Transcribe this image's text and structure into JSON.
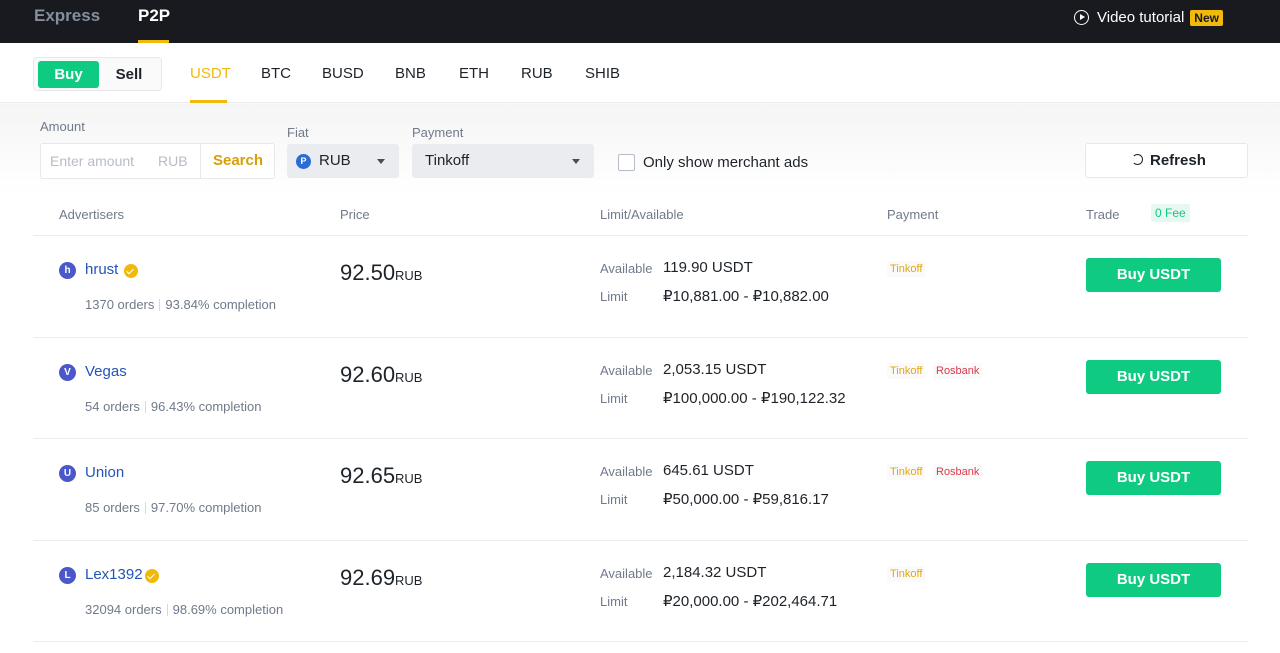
{
  "topbar": {
    "tabs": [
      "Express",
      "P2P"
    ],
    "active_tab": "P2P",
    "video_tutorial": "Video tutorial",
    "new_badge": "New"
  },
  "trade_toggle": {
    "buy": "Buy",
    "sell": "Sell",
    "active": "Buy"
  },
  "coins": [
    "USDT",
    "BTC",
    "BUSD",
    "BNB",
    "ETH",
    "RUB",
    "SHIB"
  ],
  "active_coin": "USDT",
  "filters": {
    "amount_label": "Amount",
    "amount_placeholder": "Enter amount",
    "amount_unit": "RUB",
    "search_label": "Search",
    "fiat_label": "Fiat",
    "fiat_icon": "P",
    "fiat_value": "RUB",
    "payment_label": "Payment",
    "payment_value": "Tinkoff",
    "merchant_checkbox_label": "Only show merchant ads",
    "merchant_checked": false,
    "refresh_label": "Refresh"
  },
  "table_header": {
    "advertisers": "Advertisers",
    "price": "Price",
    "limit_available": "Limit/Available",
    "payment": "Payment",
    "trade": "Trade",
    "fee_badge": "0 Fee"
  },
  "labels": {
    "available": "Available",
    "limit": "Limit"
  },
  "rows": [
    {
      "initial": "h",
      "name": "hrust",
      "verified": true,
      "orders": "1370 orders",
      "completion": "93.84% completion",
      "price": "92.50",
      "price_unit": "RUB",
      "available": "119.90 USDT",
      "limit": "₽10,881.00 - ₽10,882.00",
      "payments": [
        "Tinkoff"
      ],
      "button": "Buy USDT"
    },
    {
      "initial": "V",
      "name": "Vegas",
      "verified": false,
      "orders": "54 orders",
      "completion": "96.43% completion",
      "price": "92.60",
      "price_unit": "RUB",
      "available": "2,053.15 USDT",
      "limit": "₽100,000.00 - ₽190,122.32",
      "payments": [
        "Tinkoff",
        "Rosbank"
      ],
      "button": "Buy USDT"
    },
    {
      "initial": "U",
      "name": "Union",
      "verified": false,
      "orders": "85 orders",
      "completion": "97.70% completion",
      "price": "92.65",
      "price_unit": "RUB",
      "available": "645.61 USDT",
      "limit": "₽50,000.00 - ₽59,816.17",
      "payments": [
        "Tinkoff",
        "Rosbank"
      ],
      "button": "Buy USDT"
    },
    {
      "initial": "L",
      "name": "Lex1392",
      "verified": true,
      "orders": "32094 orders",
      "completion": "98.69% completion",
      "price": "92.69",
      "price_unit": "RUB",
      "available": "2,184.32 USDT",
      "limit": "₽20,000.00 - ₽202,464.71",
      "payments": [
        "Tinkoff"
      ],
      "button": "Buy USDT"
    }
  ],
  "colors": {
    "brand_yellow": "#f0b90b",
    "buy_green": "#0ecb81",
    "topbar_bg": "#181a20",
    "advertiser_link": "#2354b6",
    "rosbank_red": "#d83a4b"
  }
}
